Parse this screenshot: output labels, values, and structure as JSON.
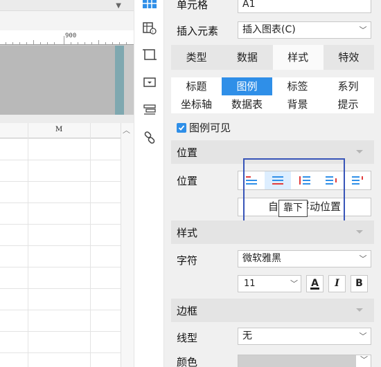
{
  "properties": {
    "cell": {
      "label": "单元格",
      "value": "A1"
    },
    "insert": {
      "label": "插入元素",
      "value": "插入图表(C)"
    },
    "tabs": [
      "类型",
      "数据",
      "样式",
      "特效"
    ],
    "subtabs": [
      "标题",
      "图例",
      "标签",
      "系列",
      "坐标轴",
      "数据表",
      "背景",
      "提示"
    ],
    "selected_subtab": "图例",
    "legend_visible_label": "图例可见",
    "sections": {
      "position": "位置",
      "style": "样式",
      "border": "边框"
    },
    "position_label": "位置",
    "position_buttons": [
      "legend-left-icon",
      "legend-bottom-icon",
      "legend-right-top-icon",
      "legend-right-icon",
      "legend-top-right-icon"
    ],
    "float_button": "自定义浮动位置",
    "tooltip": "靠下",
    "font": {
      "label": "字符",
      "family": "微软雅黑",
      "size": "11",
      "bold": "B",
      "italic": "I",
      "color_button": "A"
    },
    "line_type": {
      "label": "线型",
      "value": "无"
    },
    "color_label": "颜色"
  },
  "sheet": {
    "column_header": "M",
    "ruler_mark": "900"
  },
  "colors": {
    "accent": "#2f8fe8",
    "highlight_border": "#3754b8",
    "teal_bar": "#7fa8b0"
  }
}
